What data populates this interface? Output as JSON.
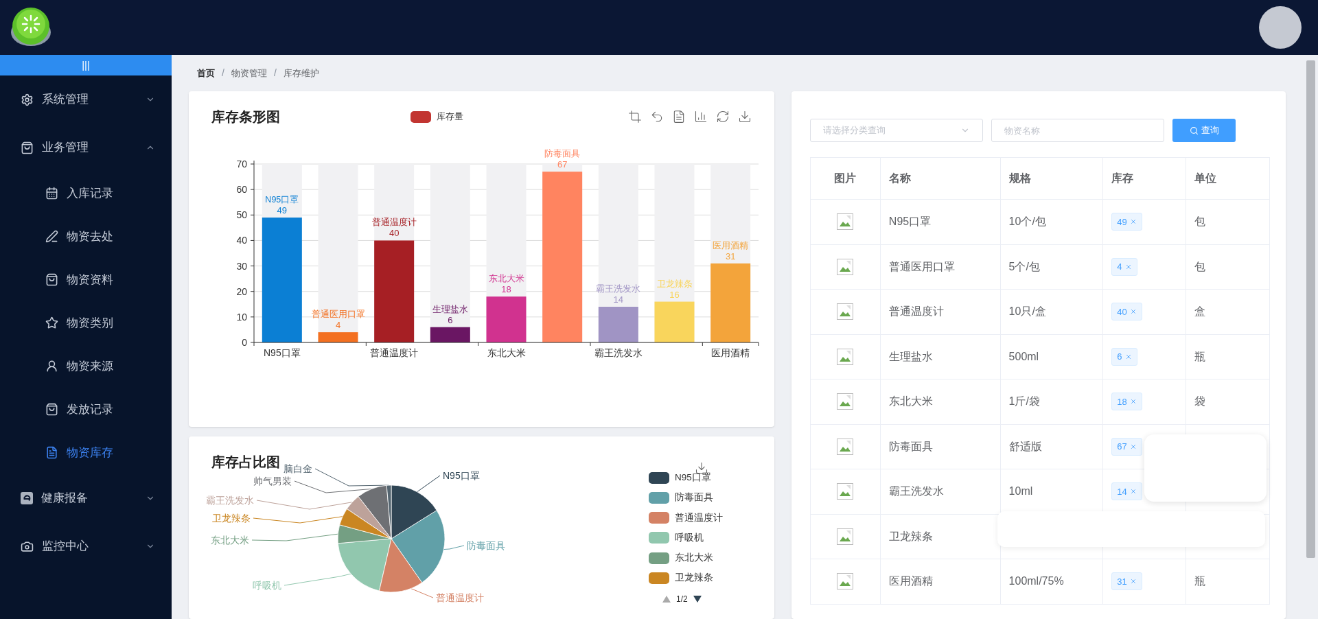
{
  "sidebar": {
    "toggle": "|||",
    "items": [
      {
        "label": "系统管理",
        "expanded": false
      },
      {
        "label": "业务管理",
        "expanded": true,
        "children": [
          {
            "label": "入库记录",
            "selected": false
          },
          {
            "label": "物资去处",
            "selected": false
          },
          {
            "label": "物资资料",
            "selected": false
          },
          {
            "label": "物资类别",
            "selected": false
          },
          {
            "label": "物资来源",
            "selected": false
          },
          {
            "label": "发放记录",
            "selected": false
          },
          {
            "label": "物资库存",
            "selected": true
          }
        ]
      },
      {
        "label": "健康报备",
        "expanded": false
      },
      {
        "label": "监控中心",
        "expanded": false
      }
    ]
  },
  "breadcrumb": {
    "separator": "/",
    "items": [
      "首页",
      "物资管理",
      "库存维护"
    ]
  },
  "bar_chart": {
    "title": "库存条形图",
    "legend": {
      "color": "#c23531"
    },
    "bars": [
      {
        "color": "#0b7fd4"
      },
      {
        "color": "#f37021"
      },
      {
        "color": "#a61f24"
      },
      {
        "color": "#6a1663"
      },
      {
        "color": "#d1328f"
      },
      {
        "color": "#ff8460"
      },
      {
        "color": "#a094c4"
      },
      {
        "color": "#f9d55c"
      },
      {
        "color": "#f3a43b"
      }
    ],
    "chart_data": {
      "type": "bar",
      "categories": [
        "N95口罩",
        "普通医用口罩",
        "普通温度计",
        "生理盐水",
        "东北大米",
        "防毒面具",
        "霸王洗发水",
        "卫龙辣条",
        "医用酒精"
      ],
      "series": [
        {
          "name": "库存量",
          "values": [
            49,
            4,
            40,
            6,
            18,
            67,
            14,
            16,
            31
          ]
        }
      ],
      "ylim": [
        0,
        70
      ],
      "yticks": [
        0,
        10,
        20,
        30,
        40,
        50,
        60,
        70
      ],
      "grid": true,
      "data_labels": true
    }
  },
  "pie_chart": {
    "title": "库存占比图",
    "pager": "1/2",
    "slices": [
      {
        "label": "脑白金",
        "color": "#546570"
      },
      {
        "label": "N95口罩",
        "color": "#2f4554"
      },
      {
        "label": "帅气男装",
        "color": "#6e7074"
      },
      {
        "label": "霸王洗发水",
        "color": "#bda29a"
      },
      {
        "label": "卫龙辣条",
        "color": "#ca8622"
      },
      {
        "label": "东北大米",
        "color": "#749f83"
      },
      {
        "label": "防毒面具",
        "color": "#61a0a8"
      },
      {
        "label": "呼吸机",
        "color": "#91c7ae"
      },
      {
        "label": "普通温度计",
        "color": "#d48265"
      }
    ],
    "legend": [
      {
        "label": "N95口罩",
        "color": "#2f4554"
      },
      {
        "label": "防毒面具",
        "color": "#61a0a8"
      },
      {
        "label": "普通温度计",
        "color": "#d48265"
      },
      {
        "label": "呼吸机",
        "color": "#91c7ae"
      },
      {
        "label": "东北大米",
        "color": "#749f83"
      },
      {
        "label": "卫龙辣条",
        "color": "#ca8622"
      }
    ]
  },
  "search": {
    "category_placeholder": "请选择分类查询",
    "name_placeholder": "物资名称",
    "button": "查询"
  },
  "table": {
    "columns": [
      "图片",
      "名称",
      "规格",
      "库存",
      "单位"
    ],
    "rows": [
      {
        "name": "N95口罩",
        "spec": "10个/包",
        "stock": "49",
        "unit": "包"
      },
      {
        "name": "普通医用口罩",
        "spec": "5个/包",
        "stock": "4",
        "unit": "包"
      },
      {
        "name": "普通温度计",
        "spec": "10只/盒",
        "stock": "40",
        "unit": "盒"
      },
      {
        "name": "生理盐水",
        "spec": "500ml",
        "stock": "6",
        "unit": "瓶"
      },
      {
        "name": "东北大米",
        "spec": "1斤/袋",
        "stock": "18",
        "unit": "袋"
      },
      {
        "name": "防毒面具",
        "spec": "舒适版",
        "stock": "67"
      },
      {
        "name": "霸王洗发水",
        "spec": "10ml",
        "stock": "14"
      },
      {
        "name": "卫龙辣条"
      },
      {
        "name": "医用酒精",
        "spec": "100ml/75%",
        "stock": "31",
        "unit": "瓶"
      }
    ]
  }
}
